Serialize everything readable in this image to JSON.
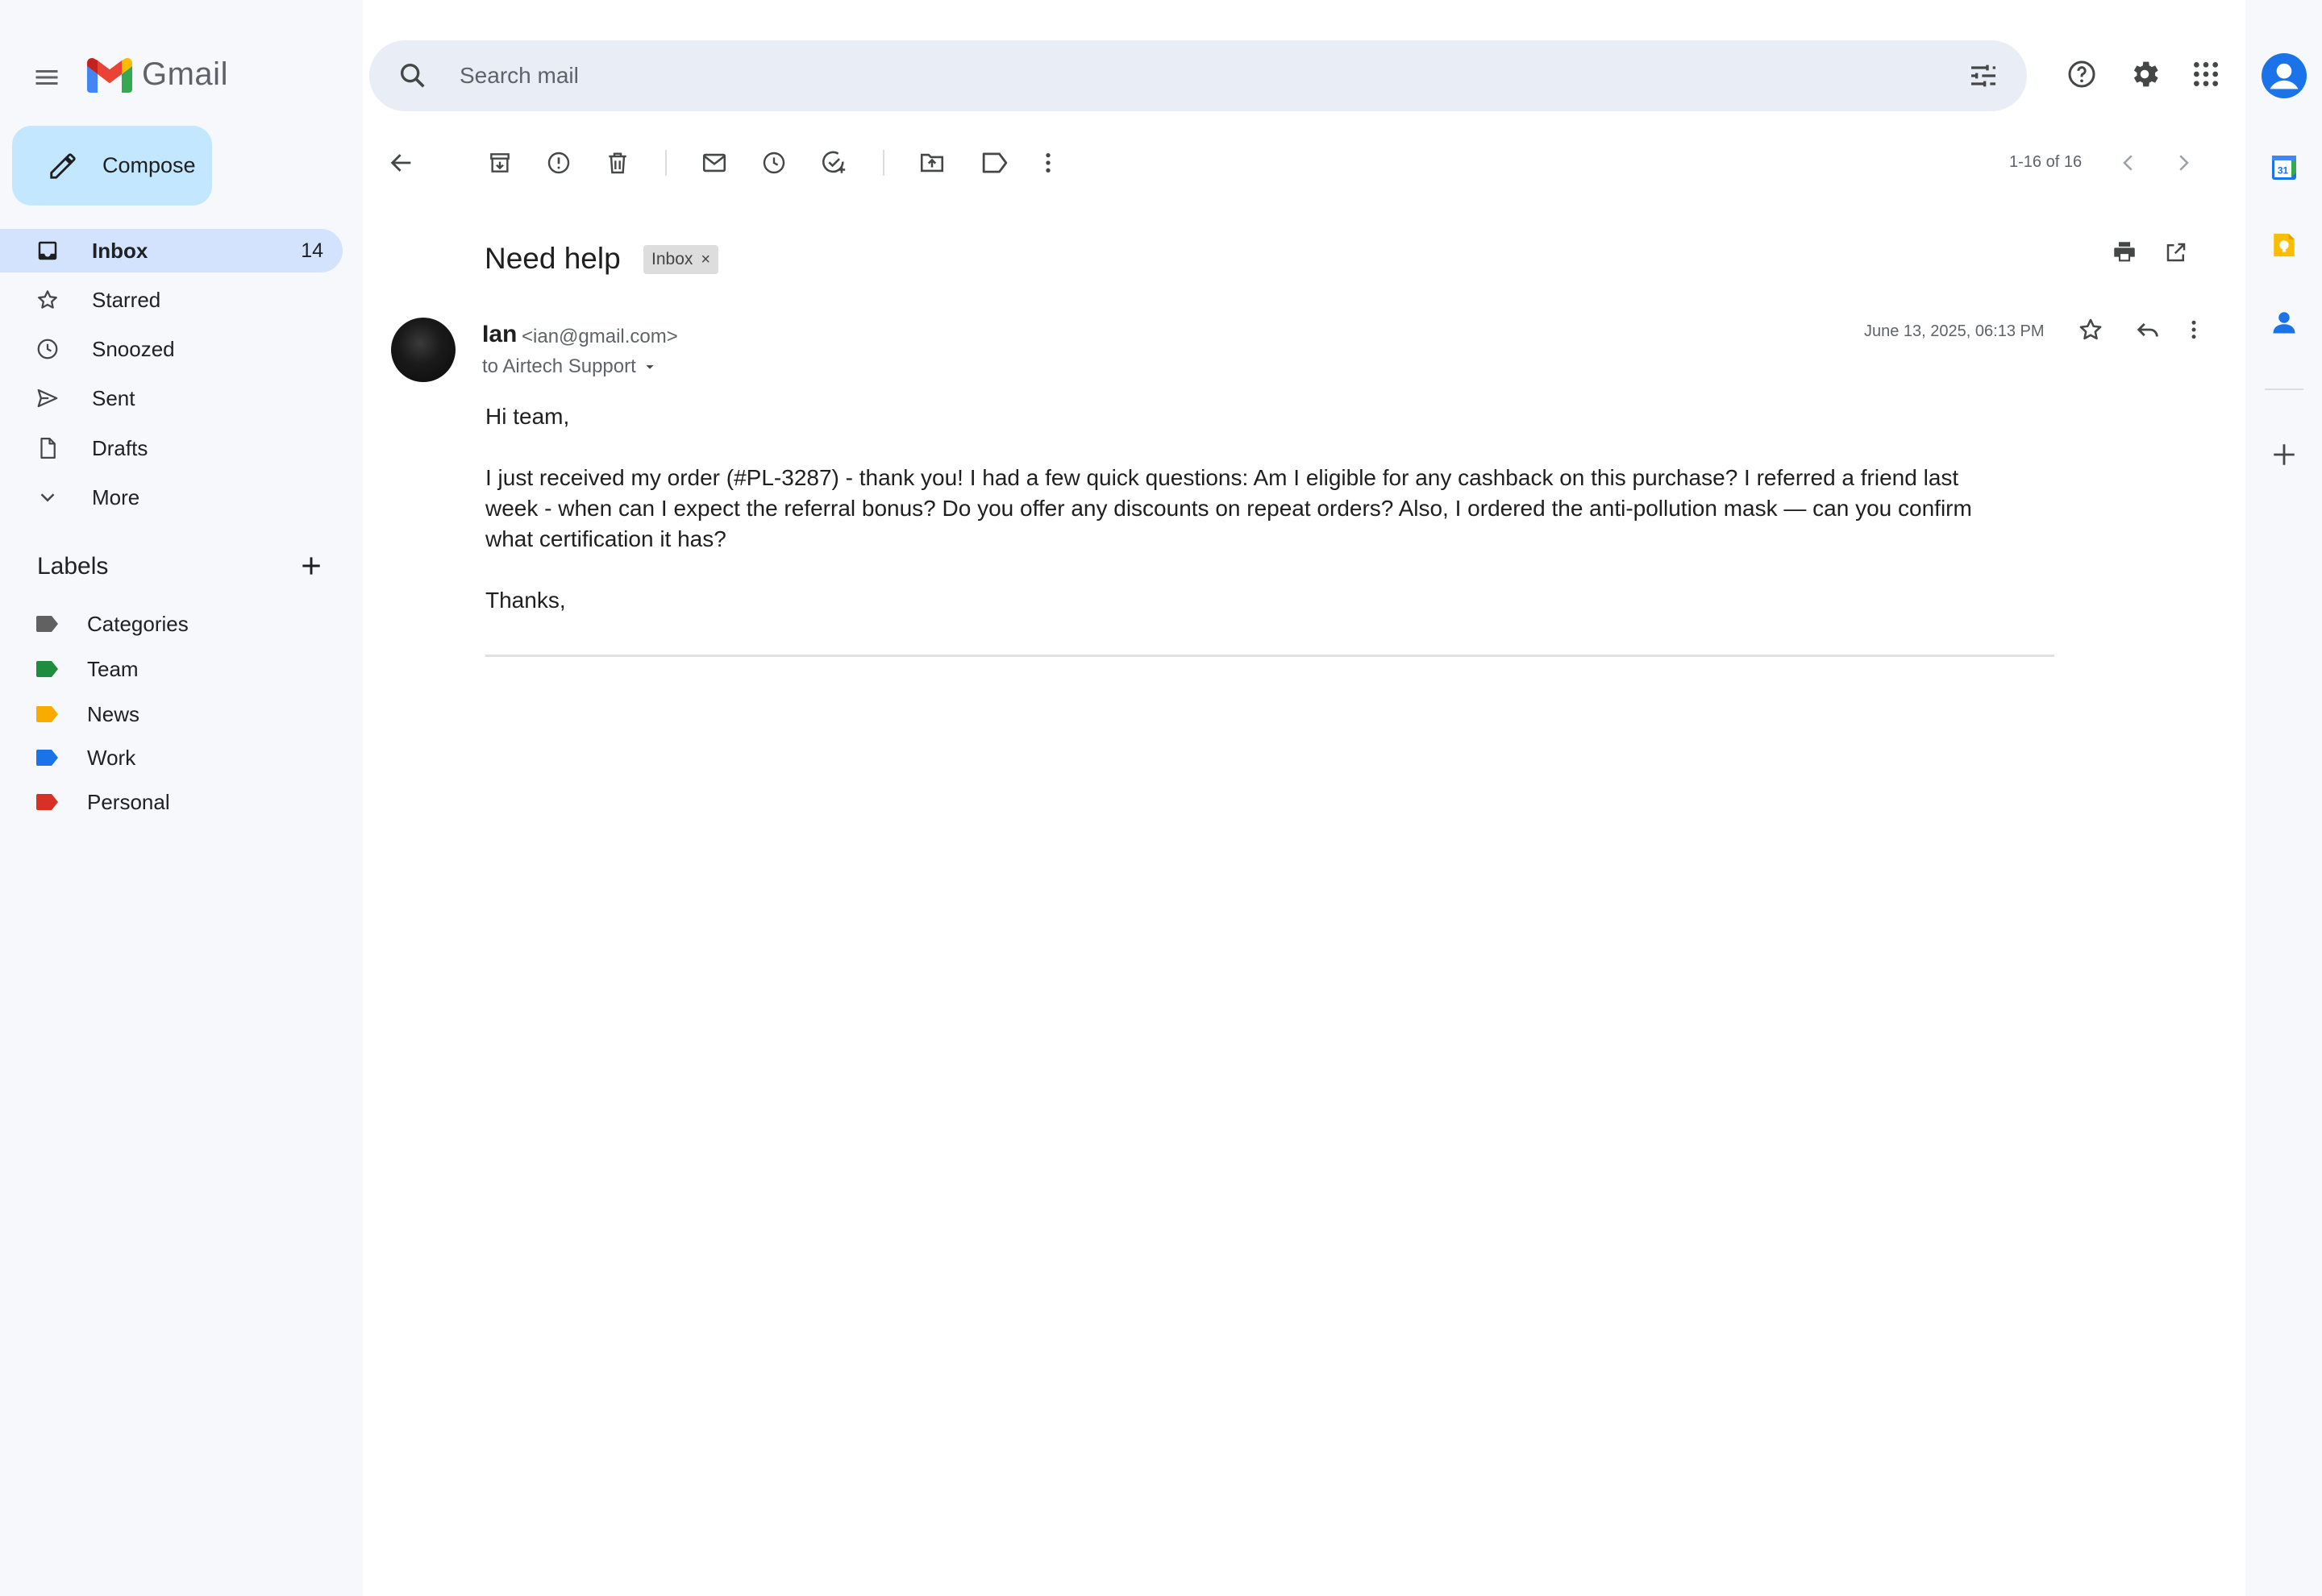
{
  "app": {
    "name": "Gmail"
  },
  "header": {
    "search_placeholder": "Search mail"
  },
  "sidebar": {
    "compose_label": "Compose",
    "items": [
      {
        "label": "Inbox",
        "count": "14"
      },
      {
        "label": "Starred"
      },
      {
        "label": "Snoozed"
      },
      {
        "label": "Sent"
      },
      {
        "label": "Drafts"
      },
      {
        "label": "More"
      }
    ],
    "labels_heading": "Labels",
    "labels": [
      {
        "name": "Categories",
        "color": "#616161"
      },
      {
        "name": "Team",
        "color": "#1e8e3e"
      },
      {
        "name": "News",
        "color": "#f9ab00"
      },
      {
        "name": "Work",
        "color": "#1a73e8"
      },
      {
        "name": "Personal",
        "color": "#d93025"
      }
    ]
  },
  "toolbar": {
    "pager": "1-16 of 16"
  },
  "email": {
    "subject": "Need help",
    "chip_label": "Inbox",
    "chip_close": "×",
    "sender_name": "Ian",
    "sender_email": "<ian@gmail.com>",
    "recipient": "to Airtech Support",
    "date": "June 13, 2025, 06:13 PM",
    "body": {
      "greeting": "Hi team,",
      "paragraph": "I just received my order (#PL-3287) - thank you! I had a few quick questions: Am I eligible for any cashback on this purchase? I referred a friend last week - when can I expect the referral bonus? Do you offer any discounts on repeat orders? Also, I ordered the anti-pollution mask — can you confirm what certification it has?",
      "signoff": "Thanks,"
    }
  },
  "colors": {
    "accent": "#0b57d0",
    "compose_bg": "#c2e7ff",
    "active_nav_bg": "#d3e3fd"
  }
}
